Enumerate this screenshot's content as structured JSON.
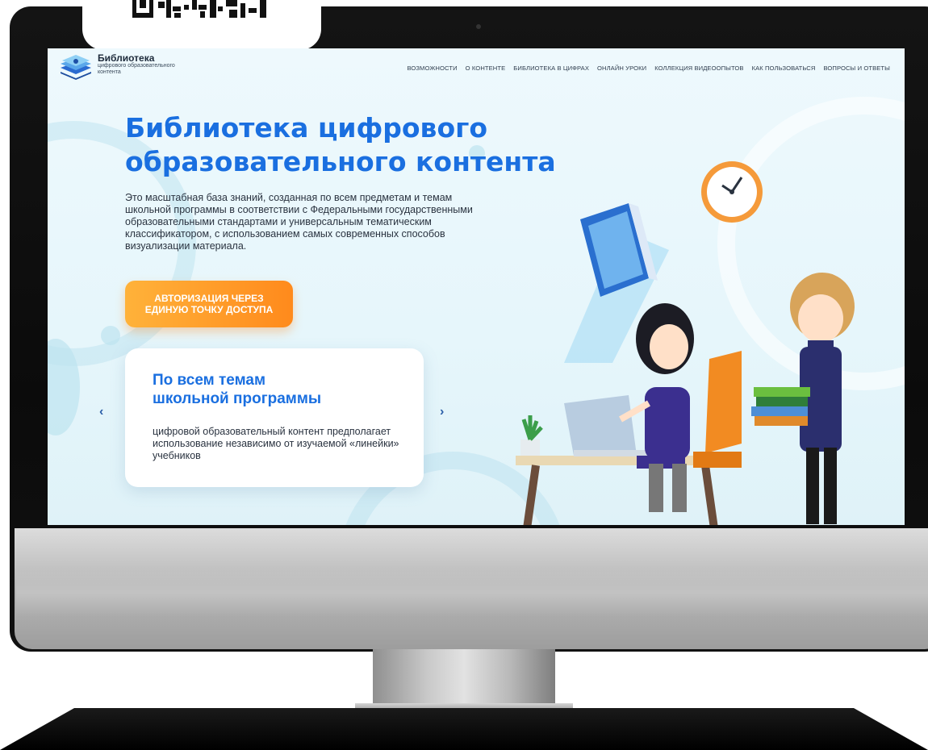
{
  "site": {
    "logo": {
      "title": "Библиотека",
      "subtitle_line1": "цифрового образовательного",
      "subtitle_line2": "контента"
    },
    "nav": [
      {
        "label": "ВОЗМОЖНОСТИ"
      },
      {
        "label": "О КОНТЕНТЕ"
      },
      {
        "label": "БИБЛИОТЕКА В ЦИФРАХ"
      },
      {
        "label": "ОНЛАЙН УРОКИ"
      },
      {
        "label": "КОЛЛЕКЦИЯ ВИДЕООПЫТОВ"
      },
      {
        "label": "КАК ПОЛЬЗОВАТЬСЯ"
      },
      {
        "label": "ВОПРОСЫ И ОТВЕТЫ"
      }
    ],
    "hero": {
      "title_line1": "Библиотека цифрового",
      "title_line2": "образовательного контента",
      "description": "Это масштабная база знаний, созданная по всем предметам и темам школьной программы в соответствии с Федеральными государственными образовательными стандартами и универсальным тематическим классификатором, с использованием самых современных способов визуализации материала.",
      "cta_line1": "АВТОРИЗАЦИЯ ЧЕРЕЗ",
      "cta_line2": "ЕДИНУЮ ТОЧКУ ДОСТУПА"
    },
    "slider": {
      "title_line1": "По всем темам",
      "title_line2": "школьной программы",
      "text": "цифровой образовательный контент предполагает использование независимо от изучаемой «линейки» учебников",
      "prev_glyph": "‹",
      "next_glyph": "›"
    }
  },
  "icons": {
    "logo": "stacked-layers-logo-icon",
    "qr": "qr-code-icon",
    "clock": "clock-icon",
    "book": "book-icon",
    "laptop": "laptop-icon",
    "plant": "plant-icon"
  },
  "colors": {
    "accent_blue": "#1a6fe0",
    "cta_orange_start": "#ffb23a",
    "cta_orange_end": "#ff8a1c",
    "screen_bg": "#eef9fd"
  }
}
